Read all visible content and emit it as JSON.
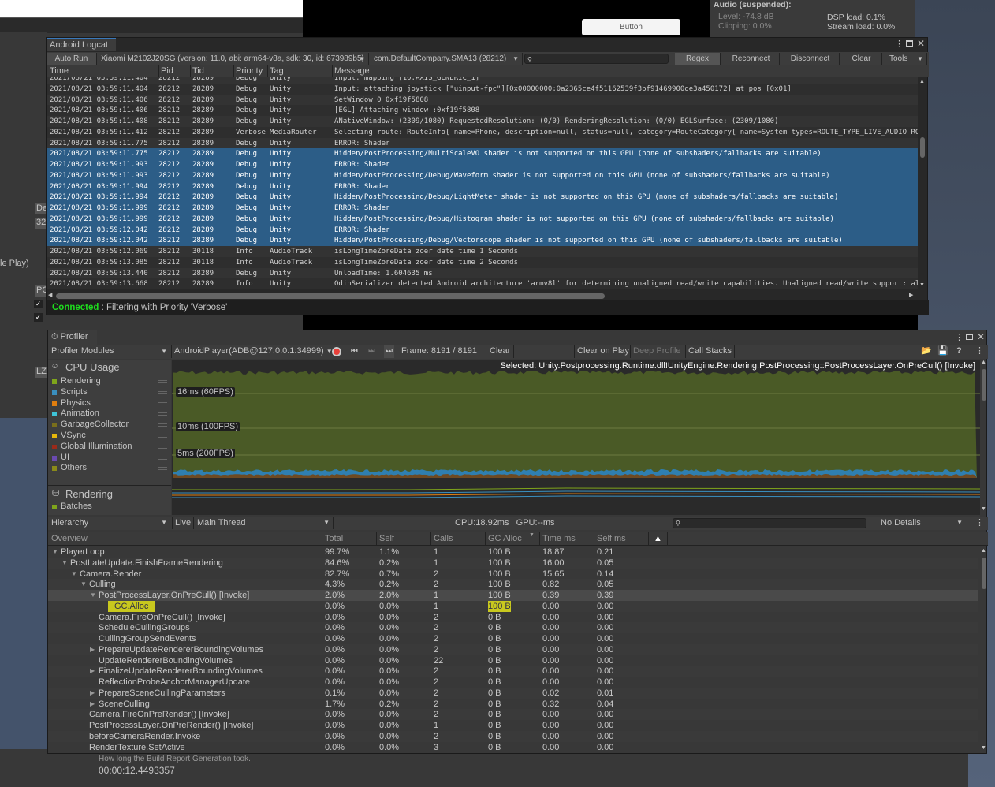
{
  "background": {
    "game_button": "Button",
    "audio": {
      "title": "Audio (suspended):",
      "level": "Level: -74.8 dB",
      "clipping": "Clipping: 0.0%",
      "dsp": "DSP load: 0.1%",
      "stream": "Stream load: 0.0%"
    },
    "left_fragments": [
      "De",
      "32",
      "le Play)",
      "PC",
      "LZ4"
    ],
    "build_report": {
      "label": "How long the Build Report Generation took.",
      "value": "00:00:12.4493357"
    }
  },
  "logcat": {
    "tab": "Android Logcat",
    "auto_run": "Auto Run",
    "device": "Xiaomi M2102J20SG (version: 11.0, abi: arm64-v8a, sdk: 30, id: 673989b5)",
    "package": "com.DefaultCompany.SMA13 (28212)",
    "search_value": "",
    "buttons": [
      "Regex",
      "Reconnect",
      "Disconnect",
      "Clear",
      "Tools"
    ],
    "columns": [
      "Time",
      "Pid",
      "Tid",
      "Priority",
      "Tag",
      "Message"
    ],
    "rows": [
      {
        "time": "2021/08/21 03:59:11.404",
        "pid": "28212",
        "tid": "28289",
        "priority": "Debug",
        "tag": "Unity",
        "message": "Input: mapping [10:AXIS_GENERIC_1]",
        "selected": false
      },
      {
        "time": "2021/08/21 03:59:11.404",
        "pid": "28212",
        "tid": "28289",
        "priority": "Debug",
        "tag": "Unity",
        "message": "Input: attaching joystick [\"uinput-fpc\"][0x00000000:0a2365ce4f51162539f3bf91469900de3a450172] at pos [0x01]",
        "selected": false
      },
      {
        "time": "2021/08/21 03:59:11.406",
        "pid": "28212",
        "tid": "28289",
        "priority": "Debug",
        "tag": "Unity",
        "message": "SetWindow 0 0xf19f5808",
        "selected": false
      },
      {
        "time": "2021/08/21 03:59:11.406",
        "pid": "28212",
        "tid": "28289",
        "priority": "Debug",
        "tag": "Unity",
        "message": "[EGL] Attaching window :0xf19f5808",
        "selected": false
      },
      {
        "time": "2021/08/21 03:59:11.408",
        "pid": "28212",
        "tid": "28289",
        "priority": "Debug",
        "tag": "Unity",
        "message": "ANativeWindow: (2309/1080) RequestedResolution: (0/0) RenderingResolution: (0/0) EGLSurface: (2309/1080)",
        "selected": false
      },
      {
        "time": "2021/08/21 03:59:11.412",
        "pid": "28212",
        "tid": "28289",
        "priority": "Verbose",
        "tag": "MediaRouter",
        "message": "Selecting route: RouteInfo{ name=Phone, description=null, status=null, category=RouteCategory{ name=System types=ROUTE_TYPE_LIVE_AUDIO ROUTE_TY",
        "selected": false
      },
      {
        "time": "2021/08/21 03:59:11.775",
        "pid": "28212",
        "tid": "28289",
        "priority": "Debug",
        "tag": "Unity",
        "message": "ERROR: Shader",
        "selected": false
      },
      {
        "time": "2021/08/21 03:59:11.775",
        "pid": "28212",
        "tid": "28289",
        "priority": "Debug",
        "tag": "Unity",
        "message": "Hidden/PostProcessing/MultiScaleVO shader is not supported on this GPU (none of subshaders/fallbacks are suitable)",
        "selected": true
      },
      {
        "time": "2021/08/21 03:59:11.993",
        "pid": "28212",
        "tid": "28289",
        "priority": "Debug",
        "tag": "Unity",
        "message": "ERROR: Shader",
        "selected": true
      },
      {
        "time": "2021/08/21 03:59:11.993",
        "pid": "28212",
        "tid": "28289",
        "priority": "Debug",
        "tag": "Unity",
        "message": "Hidden/PostProcessing/Debug/Waveform shader is not supported on this GPU (none of subshaders/fallbacks are suitable)",
        "selected": true
      },
      {
        "time": "2021/08/21 03:59:11.994",
        "pid": "28212",
        "tid": "28289",
        "priority": "Debug",
        "tag": "Unity",
        "message": "ERROR: Shader",
        "selected": true
      },
      {
        "time": "2021/08/21 03:59:11.994",
        "pid": "28212",
        "tid": "28289",
        "priority": "Debug",
        "tag": "Unity",
        "message": "Hidden/PostProcessing/Debug/LightMeter shader is not supported on this GPU (none of subshaders/fallbacks are suitable)",
        "selected": true
      },
      {
        "time": "2021/08/21 03:59:11.999",
        "pid": "28212",
        "tid": "28289",
        "priority": "Debug",
        "tag": "Unity",
        "message": "ERROR: Shader",
        "selected": true
      },
      {
        "time": "2021/08/21 03:59:11.999",
        "pid": "28212",
        "tid": "28289",
        "priority": "Debug",
        "tag": "Unity",
        "message": "Hidden/PostProcessing/Debug/Histogram shader is not supported on this GPU (none of subshaders/fallbacks are suitable)",
        "selected": true
      },
      {
        "time": "2021/08/21 03:59:12.042",
        "pid": "28212",
        "tid": "28289",
        "priority": "Debug",
        "tag": "Unity",
        "message": "ERROR: Shader",
        "selected": true
      },
      {
        "time": "2021/08/21 03:59:12.042",
        "pid": "28212",
        "tid": "28289",
        "priority": "Debug",
        "tag": "Unity",
        "message": "Hidden/PostProcessing/Debug/Vectorscope shader is not supported on this GPU (none of subshaders/fallbacks are suitable)",
        "selected": true
      },
      {
        "time": "2021/08/21 03:59:12.069",
        "pid": "28212",
        "tid": "30118",
        "priority": "Info",
        "tag": "AudioTrack",
        "message": "isLongTimeZoreData zoer date time 1 Seconds",
        "selected": false
      },
      {
        "time": "2021/08/21 03:59:13.085",
        "pid": "28212",
        "tid": "30118",
        "priority": "Info",
        "tag": "AudioTrack",
        "message": "isLongTimeZoreData zoer date time 2 Seconds",
        "selected": false
      },
      {
        "time": "2021/08/21 03:59:13.440",
        "pid": "28212",
        "tid": "28289",
        "priority": "Debug",
        "tag": "Unity",
        "message": "UnloadTime: 1.604635 ms",
        "selected": false
      },
      {
        "time": "2021/08/21 03:59:13.668",
        "pid": "28212",
        "tid": "28289",
        "priority": "Info",
        "tag": "Unity",
        "message": "OdinSerializer detected Android architecture 'armv8l' for determining unaligned read/write capabilities. Unaligned read/write support: all=Fals",
        "selected": false
      }
    ],
    "status": {
      "connected": "Connected",
      "text": " : Filtering with Priority 'Verbose'"
    }
  },
  "profiler": {
    "tab": "Profiler",
    "modules_dropdown": "Profiler Modules",
    "target": "AndroidPlayer(ADB@127.0.0.1:34999)",
    "frame": "Frame: 8191 / 8191",
    "buttons": {
      "clear": "Clear",
      "clear_on_play": "Clear on Play",
      "deep_profile": "Deep Profile",
      "call_stacks": "Call Stacks"
    },
    "selected_label": "Selected: Unity.Postprocessing.Runtime.dll!UnityEngine.Rendering.PostProcessing::PostProcessLayer.OnPreCull() [Invoke]",
    "cpu_module": {
      "title": "CPU Usage",
      "items": [
        {
          "label": "Rendering",
          "color": "#7fa51b"
        },
        {
          "label": "Scripts",
          "color": "#3a8fbf"
        },
        {
          "label": "Physics",
          "color": "#e07e0f"
        },
        {
          "label": "Animation",
          "color": "#3ec4d8"
        },
        {
          "label": "GarbageCollector",
          "color": "#7a6f1b"
        },
        {
          "label": "VSync",
          "color": "#e8b80b"
        },
        {
          "label": "Global Illumination",
          "color": "#9c2a1a"
        },
        {
          "label": "UI",
          "color": "#6a4ab0"
        },
        {
          "label": "Others",
          "color": "#8a8a1a"
        }
      ]
    },
    "chart_labels": [
      "16ms (60FPS)",
      "10ms (100FPS)",
      "5ms (200FPS)"
    ],
    "rendering_module": {
      "title": "Rendering",
      "items": [
        {
          "label": "Batches",
          "color": "#7fa51b"
        }
      ]
    },
    "hierarchy_toolbar": {
      "view": "Hierarchy",
      "live": "Live",
      "thread": "Main Thread",
      "timing": "CPU:18.92ms   GPU:--ms",
      "search_value": "",
      "details": "No Details"
    },
    "columns": [
      "Overview",
      "Total",
      "Self",
      "Calls",
      "GC Alloc",
      "Time ms",
      "Self ms"
    ],
    "rows": [
      {
        "name": "PlayerLoop",
        "depth": 0,
        "arrow": "expanded",
        "total": "99.7%",
        "self": "1.1%",
        "calls": "1",
        "gc": "100 B",
        "time": "18.87",
        "selfms": "0.21"
      },
      {
        "name": "PostLateUpdate.FinishFrameRendering",
        "depth": 1,
        "arrow": "expanded",
        "total": "84.6%",
        "self": "0.2%",
        "calls": "1",
        "gc": "100 B",
        "time": "16.00",
        "selfms": "0.05"
      },
      {
        "name": "Camera.Render",
        "depth": 2,
        "arrow": "expanded",
        "total": "82.7%",
        "self": "0.7%",
        "calls": "2",
        "gc": "100 B",
        "time": "15.65",
        "selfms": "0.14"
      },
      {
        "name": "Culling",
        "depth": 3,
        "arrow": "expanded",
        "total": "4.3%",
        "self": "0.2%",
        "calls": "2",
        "gc": "100 B",
        "time": "0.82",
        "selfms": "0.05"
      },
      {
        "name": "PostProcessLayer.OnPreCull() [Invoke]",
        "depth": 4,
        "arrow": "expanded",
        "selected": true,
        "total": "2.0%",
        "self": "2.0%",
        "calls": "1",
        "gc": "100 B",
        "time": "0.39",
        "selfms": "0.39"
      },
      {
        "name": "GC.Alloc",
        "depth": 5,
        "arrow": "none",
        "highlight": true,
        "total": "0.0%",
        "self": "0.0%",
        "calls": "1",
        "gc": "100 B",
        "time": "0.00",
        "selfms": "0.00"
      },
      {
        "name": "Camera.FireOnPreCull() [Invoke]",
        "depth": 4,
        "arrow": "none",
        "total": "0.0%",
        "self": "0.0%",
        "calls": "2",
        "gc": "0 B",
        "time": "0.00",
        "selfms": "0.00"
      },
      {
        "name": "ScheduleCullingGroups",
        "depth": 4,
        "arrow": "none",
        "total": "0.0%",
        "self": "0.0%",
        "calls": "2",
        "gc": "0 B",
        "time": "0.00",
        "selfms": "0.00"
      },
      {
        "name": "CullingGroupSendEvents",
        "depth": 4,
        "arrow": "none",
        "total": "0.0%",
        "self": "0.0%",
        "calls": "2",
        "gc": "0 B",
        "time": "0.00",
        "selfms": "0.00"
      },
      {
        "name": "PrepareUpdateRendererBoundingVolumes",
        "depth": 4,
        "arrow": "collapsed",
        "total": "0.0%",
        "self": "0.0%",
        "calls": "2",
        "gc": "0 B",
        "time": "0.00",
        "selfms": "0.00"
      },
      {
        "name": "UpdateRendererBoundingVolumes",
        "depth": 4,
        "arrow": "none",
        "total": "0.0%",
        "self": "0.0%",
        "calls": "22",
        "gc": "0 B",
        "time": "0.00",
        "selfms": "0.00"
      },
      {
        "name": "FinalizeUpdateRendererBoundingVolumes",
        "depth": 4,
        "arrow": "collapsed",
        "total": "0.0%",
        "self": "0.0%",
        "calls": "2",
        "gc": "0 B",
        "time": "0.00",
        "selfms": "0.00"
      },
      {
        "name": "ReflectionProbeAnchorManagerUpdate",
        "depth": 4,
        "arrow": "none",
        "total": "0.0%",
        "self": "0.0%",
        "calls": "2",
        "gc": "0 B",
        "time": "0.00",
        "selfms": "0.00"
      },
      {
        "name": "PrepareSceneCullingParameters",
        "depth": 4,
        "arrow": "collapsed",
        "total": "0.1%",
        "self": "0.0%",
        "calls": "2",
        "gc": "0 B",
        "time": "0.02",
        "selfms": "0.01"
      },
      {
        "name": "SceneCulling",
        "depth": 4,
        "arrow": "collapsed",
        "total": "1.7%",
        "self": "0.2%",
        "calls": "2",
        "gc": "0 B",
        "time": "0.32",
        "selfms": "0.04"
      },
      {
        "name": "Camera.FireOnPreRender() [Invoke]",
        "depth": 3,
        "arrow": "none",
        "total": "0.0%",
        "self": "0.0%",
        "calls": "2",
        "gc": "0 B",
        "time": "0.00",
        "selfms": "0.00"
      },
      {
        "name": "PostProcessLayer.OnPreRender() [Invoke]",
        "depth": 3,
        "arrow": "none",
        "total": "0.0%",
        "self": "0.0%",
        "calls": "1",
        "gc": "0 B",
        "time": "0.00",
        "selfms": "0.00"
      },
      {
        "name": "beforeCameraRender.Invoke",
        "depth": 3,
        "arrow": "none",
        "total": "0.0%",
        "self": "0.0%",
        "calls": "2",
        "gc": "0 B",
        "time": "0.00",
        "selfms": "0.00"
      },
      {
        "name": "RenderTexture.SetActive",
        "depth": 3,
        "arrow": "none",
        "total": "0.0%",
        "self": "0.0%",
        "calls": "3",
        "gc": "0 B",
        "time": "0.00",
        "selfms": "0.00"
      }
    ]
  }
}
